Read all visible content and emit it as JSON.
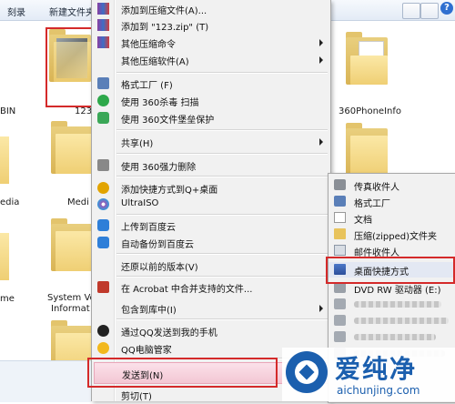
{
  "explorer": {
    "toolbar": {
      "burn": "刻录",
      "new_folder": "新建文件夹"
    },
    "items": [
      {
        "label": "123"
      },
      {
        "label": "BIN"
      },
      {
        "label": "edia"
      },
      {
        "label": "Medi"
      },
      {
        "label": "me"
      },
      {
        "label": "System Vo"
      },
      {
        "label": "Informat"
      },
      {
        "label": "360PhoneInfo"
      }
    ]
  },
  "context_menu": {
    "items": [
      {
        "label": "添加到压缩文件(A)..."
      },
      {
        "label": "添加到 \"123.zip\" (T)"
      },
      {
        "label": "其他压缩命令"
      },
      {
        "label": "其他压缩软件(A)"
      },
      {
        "label": "格式工厂 (F)"
      },
      {
        "label": "使用 360杀毒 扫描"
      },
      {
        "label": "使用 360文件堡垒保护"
      },
      {
        "label": "共享(H)"
      },
      {
        "label": "使用 360强力删除"
      },
      {
        "label": "添加快捷方式到Q+桌面"
      },
      {
        "label": "UltraISO"
      },
      {
        "label": "上传到百度云"
      },
      {
        "label": "自动备份到百度云"
      },
      {
        "label": "还原以前的版本(V)"
      },
      {
        "label": "在 Acrobat 中合并支持的文件..."
      },
      {
        "label": "包含到库中(I)"
      },
      {
        "label": "通过QQ发送到我的手机"
      },
      {
        "label": "QQ电脑管家"
      },
      {
        "label": "发送到(N)"
      },
      {
        "label": "剪切(T)"
      }
    ]
  },
  "send_to_submenu": {
    "items": [
      {
        "label": "传真收件人"
      },
      {
        "label": "格式工厂"
      },
      {
        "label": "文档"
      },
      {
        "label": "压缩(zipped)文件夹"
      },
      {
        "label": "邮件收件人"
      },
      {
        "label": "桌面快捷方式"
      },
      {
        "label": "DVD RW 驱动器 (E:)"
      }
    ]
  },
  "watermark": {
    "brand": "爱纯净",
    "site": "aichunjing.com"
  },
  "colors": {
    "highlight_red": "#d42a2a",
    "brand_blue": "#1b5fae"
  }
}
